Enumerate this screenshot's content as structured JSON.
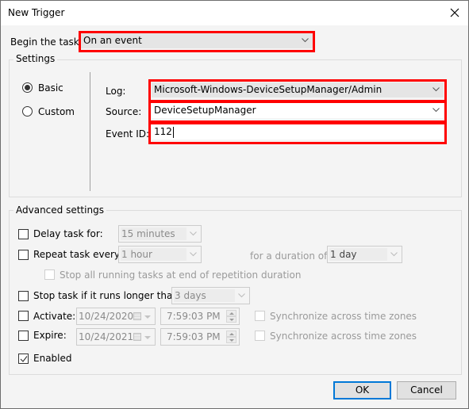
{
  "window": {
    "title": "New Trigger"
  },
  "begin_task": {
    "label": "Begin the task:",
    "value": "On an event"
  },
  "settings": {
    "legend": "Settings",
    "mode_options": [
      {
        "label": "Basic",
        "checked": true
      },
      {
        "label": "Custom",
        "checked": false
      }
    ],
    "log": {
      "label": "Log:",
      "value": "Microsoft-Windows-DeviceSetupManager/Admin"
    },
    "source": {
      "label": "Source:",
      "value": "DeviceSetupManager"
    },
    "event_id": {
      "label": "Event ID:",
      "value": "112"
    }
  },
  "advanced": {
    "legend": "Advanced settings",
    "delay": {
      "label": "Delay task for:",
      "checked": false,
      "value": "15 minutes"
    },
    "repeat": {
      "label": "Repeat task every:",
      "checked": false,
      "value": "1 hour",
      "duration_label": "for a duration of:",
      "duration_value": "1 day"
    },
    "stop_all": {
      "label": "Stop all running tasks at end of repetition duration",
      "checked": false
    },
    "stop_if_longer": {
      "label": "Stop task if it runs longer than:",
      "checked": false,
      "value": "3 days"
    },
    "activate": {
      "label": "Activate:",
      "checked": false,
      "date": "10/24/2020",
      "time": "7:59:03 PM",
      "sync_label": "Synchronize across time zones",
      "sync_checked": false
    },
    "expire": {
      "label": "Expire:",
      "checked": false,
      "date": "10/24/2021",
      "time": "7:59:03 PM",
      "sync_label": "Synchronize across time zones",
      "sync_checked": false
    },
    "enabled": {
      "label": "Enabled",
      "checked": true
    }
  },
  "buttons": {
    "ok": "OK",
    "cancel": "Cancel"
  },
  "colors": {
    "highlight": "#ff0000",
    "default_button_border": "#0078d7"
  }
}
